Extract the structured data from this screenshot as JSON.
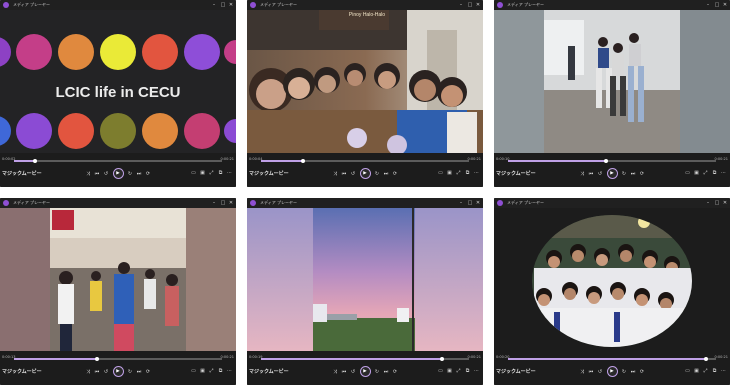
{
  "app": {
    "title": "メディア プレーヤー",
    "caption": "マジックムービー"
  },
  "windows": [
    {
      "id": "w1",
      "video_text": "LCIC life  in CECU",
      "time_current": "0:00:02",
      "time_total": "0:00:21",
      "progress": 0.1
    },
    {
      "id": "w2",
      "video_text": "Pinoy Halo-Halo",
      "time_current": "0:00:04",
      "time_total": "0:00:21",
      "progress": 0.2
    },
    {
      "id": "w3",
      "time_current": "0:00:10",
      "time_total": "0:00:21",
      "progress": 0.47
    },
    {
      "id": "w4",
      "time_current": "0:00:13",
      "time_total": "0:00:21",
      "progress": 0.4
    },
    {
      "id": "w5",
      "time_current": "0:00:19",
      "time_total": "0:00:21",
      "progress": 0.87
    },
    {
      "id": "w6",
      "time_current": "0:00:20",
      "time_total": "0:00:21",
      "progress": 0.95
    }
  ],
  "controls": {
    "shuffle": "⤨",
    "previous": "⏮",
    "rewind": "↺",
    "play": "▶",
    "forward": "↻",
    "next": "⏭",
    "repeat": "⟳",
    "subtitles": "▭",
    "cast": "▣",
    "fullscreen": "⤢",
    "miniplayer": "⧉",
    "more": "⋯"
  },
  "window_controls": {
    "minimize": "–",
    "maximize": "□",
    "close": "✕"
  },
  "colors": {
    "accent": "#bfa0e6",
    "titlebar": "#202020",
    "controls_bg": "#1c1c1c"
  }
}
